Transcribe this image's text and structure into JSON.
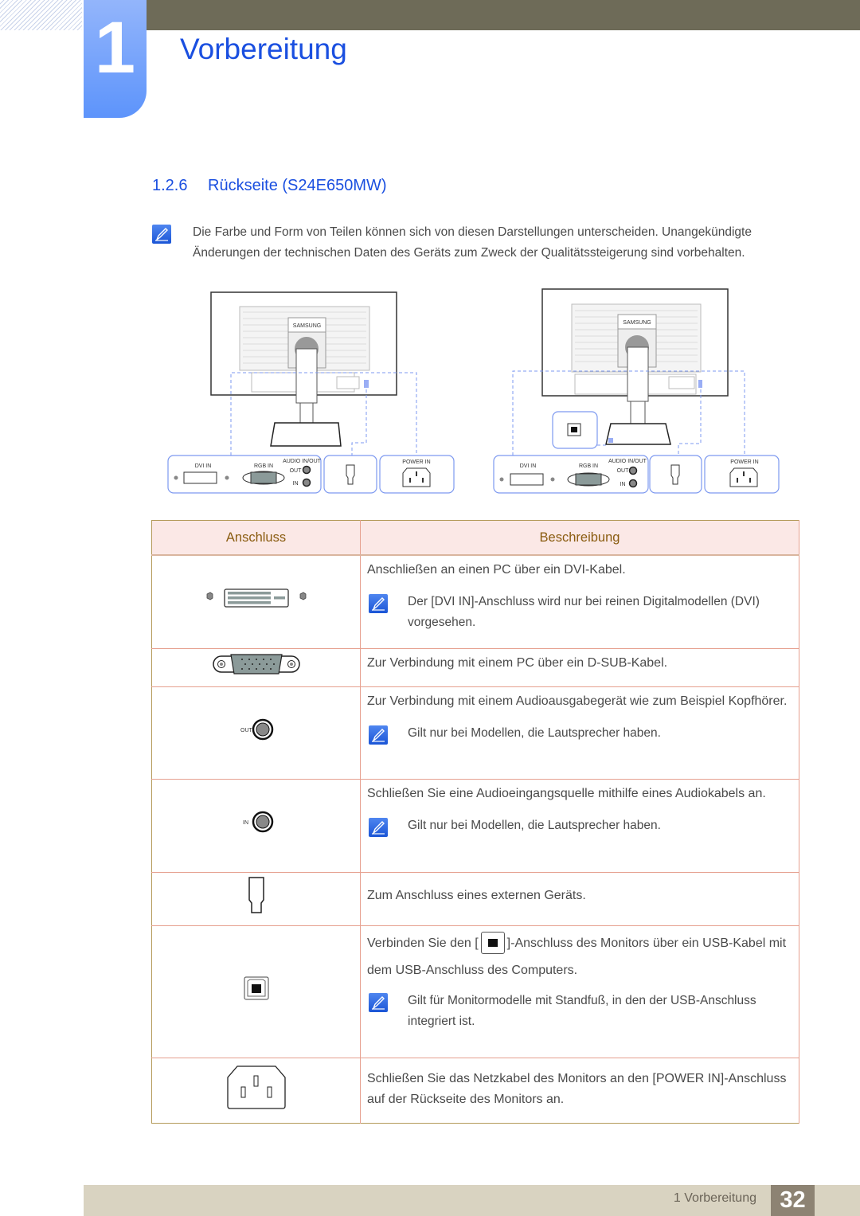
{
  "chapter": {
    "number": "1",
    "title": "Vorbereitung"
  },
  "section": {
    "number": "1.2.6",
    "title": "Rückseite (S24E650MW)"
  },
  "intro_note": {
    "icon": "note-pencil-icon",
    "text": "Die Farbe und Form von Teilen können sich von diesen Darstellungen unterscheiden. Unangekündigte Änderungen der technischen Daten des Geräts zum Zweck der Qualitätssteigerung sind vorbehalten."
  },
  "figures": {
    "labels": {
      "dvi_in": "DVI IN",
      "rgb_in": "RGB IN",
      "audio_in_out": "AUDIO IN/OUT",
      "out": "OUT",
      "in": "IN",
      "power_in": "POWER IN",
      "brand": "SAMSUNG"
    }
  },
  "table": {
    "headers": {
      "connector": "Anschluss",
      "description": "Beschreibung"
    },
    "rows": [
      {
        "connector_icon": "dvi-port-icon",
        "text": "Anschließen an einen PC über ein DVI-Kabel.",
        "note": "Der [DVI IN]-Anschluss wird nur bei reinen Digitalmodellen (DVI) vorgesehen."
      },
      {
        "connector_icon": "vga-port-icon",
        "text": "Zur Verbindung mit einem PC über ein D-SUB-Kabel."
      },
      {
        "connector_icon": "audio-out-jack-icon",
        "connector_label": "OUT",
        "text": "Zur Verbindung mit einem Audioausgabegerät wie zum Beispiel Kopfhörer.",
        "note": "Gilt nur bei Modellen, die Lautsprecher haben."
      },
      {
        "connector_icon": "audio-in-jack-icon",
        "connector_label": "IN",
        "text": "Schließen Sie eine Audioeingangsquelle mithilfe eines Audiokabels an.",
        "note": "Gilt nur bei Modellen, die Lautsprecher haben."
      },
      {
        "connector_icon": "external-device-port-icon",
        "text": "Zum Anschluss eines externen Geräts."
      },
      {
        "connector_icon": "usb-b-port-icon",
        "text_before": "Verbinden Sie den [",
        "text_after": "]-Anschluss des Monitors über ein USB-Kabel mit dem USB-Anschluss des Computers.",
        "note": "Gilt für Monitormodelle mit Standfuß, in den der USB-Anschluss integriert ist."
      },
      {
        "connector_icon": "power-in-port-icon",
        "text": "Schließen Sie das Netzkabel des Monitors an den [POWER IN]-Anschluss auf der Rückseite des Monitors an."
      }
    ]
  },
  "footer": {
    "label": "1 Vorbereitung",
    "page": "32"
  },
  "colors": {
    "accent_blue": "#1a4fe0",
    "header_bar": "#6e6b58",
    "table_header_bg": "#fbe8e6",
    "table_header_text": "#8a5c10",
    "footer_bg": "#d9d3c1",
    "page_num_bg": "#8d8373"
  }
}
